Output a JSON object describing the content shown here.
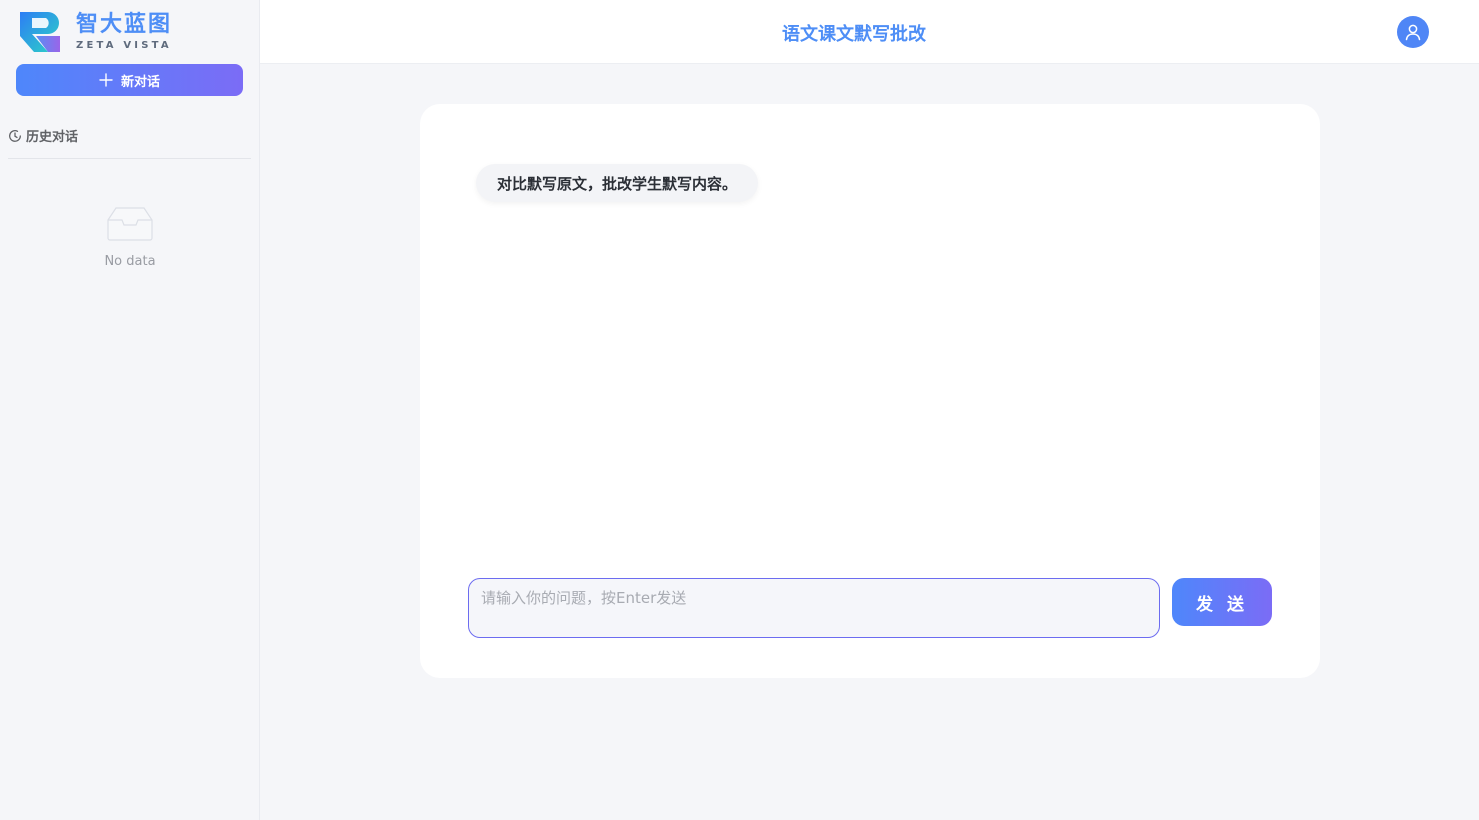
{
  "brand": {
    "name_cn": "智大蓝图",
    "name_en": "ZETA VISTA"
  },
  "sidebar": {
    "new_chat_label": "新对话",
    "history_label": "历史对话",
    "empty_text": "No data"
  },
  "header": {
    "title": "语文课文默写批改"
  },
  "chat": {
    "messages": [
      {
        "role": "assistant",
        "text": "对比默写原文，批改学生默写内容。"
      }
    ],
    "input_placeholder": "请输入你的问题，按Enter发送",
    "input_value": "",
    "send_label": "发 送"
  },
  "icons": {
    "new_chat": "plus-icon",
    "history": "clock-history-icon",
    "empty": "inbox-empty-icon",
    "user": "user-icon"
  },
  "colors": {
    "accent": "#4e8ef6",
    "gradient_start": "#4e87fb",
    "gradient_end": "#7b6cf6",
    "background": "#f5f6f9"
  }
}
